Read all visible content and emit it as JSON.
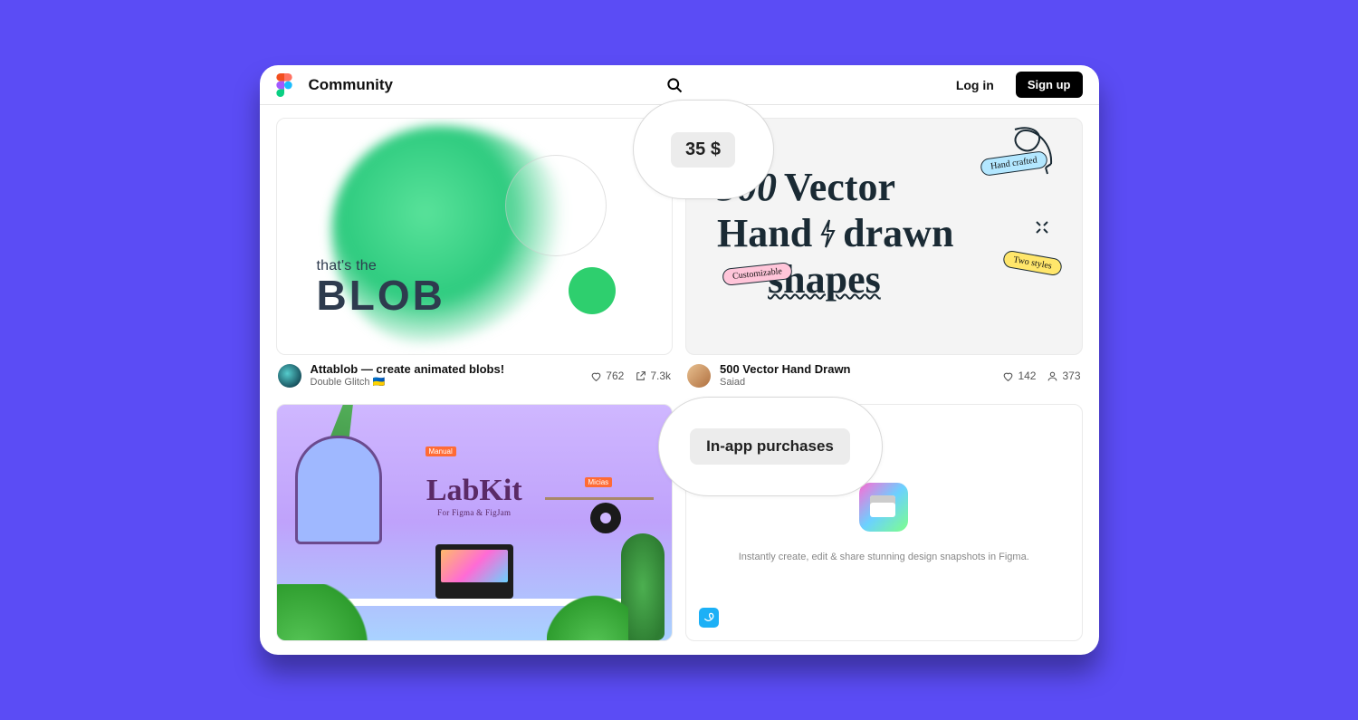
{
  "header": {
    "brand": "Community",
    "login": "Log in",
    "signup": "Sign up"
  },
  "callouts": {
    "price": "35 $",
    "iap": "In-app purchases"
  },
  "cards": [
    {
      "thumb": {
        "small": "that's the",
        "big": "BLOB"
      },
      "title": "Attablob — create animated blobs!",
      "subtitle": "Double Glitch 🇺🇦",
      "likes": "762",
      "uses": "7.3k"
    },
    {
      "thumb": {
        "n500": "500",
        "vector": "Vector",
        "hand": "Hand",
        "drawn": "drawn",
        "shapes": "shapes",
        "pill_blue": "Hand crafted",
        "pill_pink": "Customizable",
        "pill_yellow": "Two styles"
      },
      "title": "500 Vector Hand Drawn",
      "subtitle": "Saiad",
      "likes": "142",
      "users": "373"
    },
    {
      "thumb": {
        "big": "LabKit",
        "sub": "For Figma & FigJam",
        "tag1": "Manual",
        "tag2": "Micias"
      }
    },
    {
      "thumb": {
        "desc": "Instantly create, edit & share stunning design snapshots in Figma."
      }
    }
  ]
}
